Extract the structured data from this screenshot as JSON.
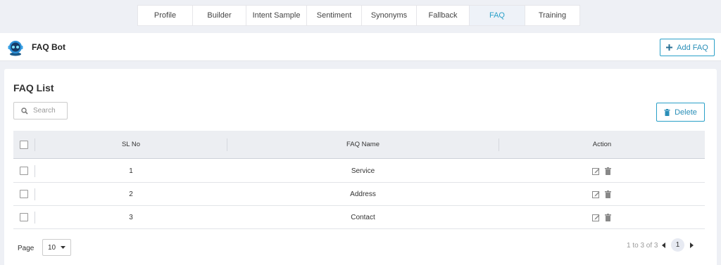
{
  "tabs": [
    {
      "label": "Profile"
    },
    {
      "label": "Builder"
    },
    {
      "label": "Intent Sample"
    },
    {
      "label": "Sentiment"
    },
    {
      "label": "Synonyms"
    },
    {
      "label": "Fallback"
    },
    {
      "label": "FAQ",
      "active": true
    },
    {
      "label": "Training"
    }
  ],
  "bot": {
    "name": "FAQ Bot",
    "add_button_label": "Add FAQ"
  },
  "faq_list": {
    "title": "FAQ List",
    "search_placeholder": "Search",
    "delete_label": "Delete",
    "columns": [
      "SL No",
      "FAQ Name",
      "Action"
    ],
    "rows": [
      {
        "sl_no": "1",
        "name": "Service"
      },
      {
        "sl_no": "2",
        "name": "Address"
      },
      {
        "sl_no": "3",
        "name": "Contact"
      }
    ]
  },
  "pagination": {
    "page_label": "Page",
    "page_size": "10",
    "range_text": "1 to 3 of 3",
    "current_page": "1"
  },
  "colors": {
    "accent": "#2aa0c8",
    "background": "#eef0f5"
  },
  "icons": [
    "robot-avatar-icon",
    "plus-icon",
    "search-icon",
    "trash-icon",
    "edit-icon",
    "caret-down-icon",
    "prev-arrow-icon",
    "next-arrow-icon"
  ]
}
